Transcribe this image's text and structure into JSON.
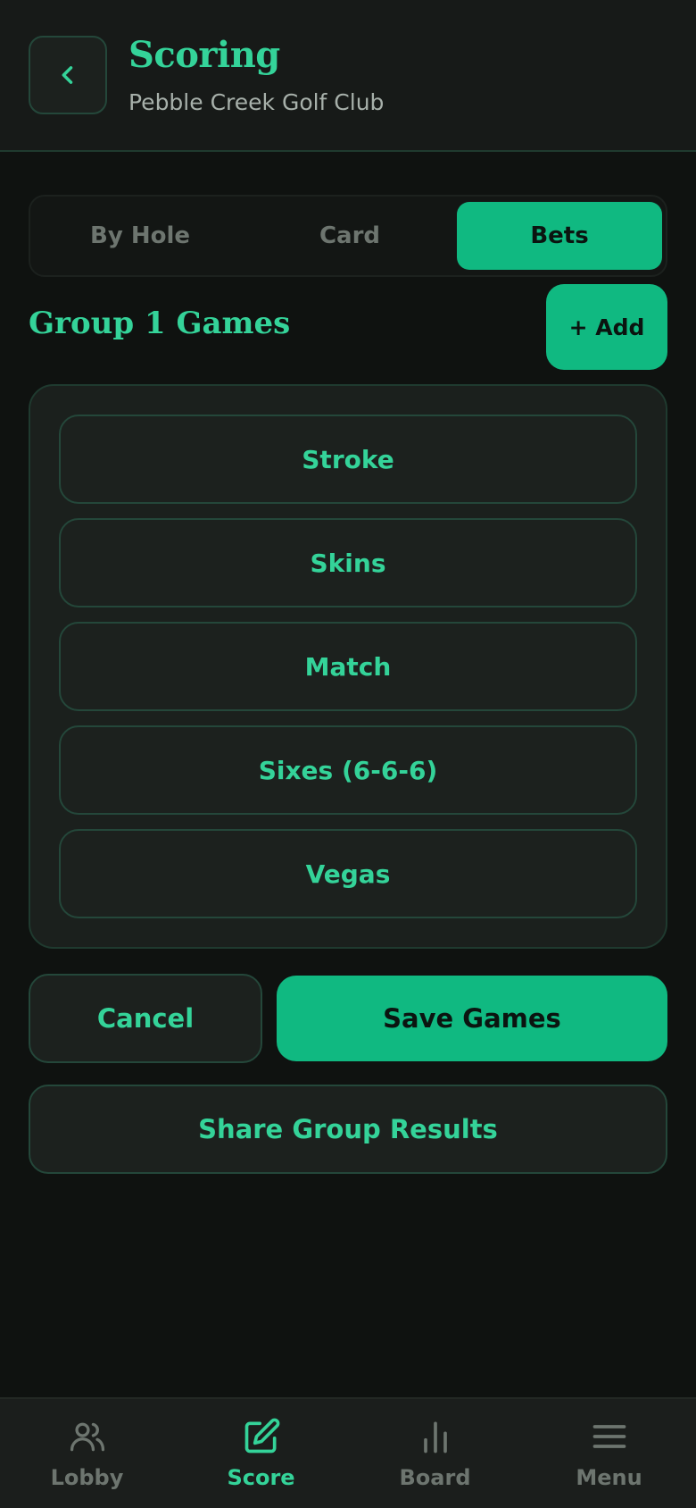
{
  "header": {
    "title": "Scoring",
    "subtitle": "Pebble Creek Golf Club",
    "back_icon": "chevron-left-icon"
  },
  "tabs": [
    {
      "label": "By Hole",
      "active": false
    },
    {
      "label": "Card",
      "active": false
    },
    {
      "label": "Bets",
      "active": true
    }
  ],
  "section": {
    "title": "Group 1 Games",
    "add_label": "+ Add"
  },
  "games": [
    {
      "label": "Stroke"
    },
    {
      "label": "Skins"
    },
    {
      "label": "Match"
    },
    {
      "label": "Sixes (6-6-6)"
    },
    {
      "label": "Vegas"
    }
  ],
  "actions": {
    "cancel_label": "Cancel",
    "save_label": "Save Games",
    "share_label": "Share Group Results"
  },
  "bottom_nav": [
    {
      "label": "Lobby",
      "icon": "users-icon",
      "active": false
    },
    {
      "label": "Score",
      "icon": "edit-icon",
      "active": true
    },
    {
      "label": "Board",
      "icon": "bar-chart-icon",
      "active": false
    },
    {
      "label": "Menu",
      "icon": "menu-icon",
      "active": false
    }
  ],
  "colors": {
    "accent": "#10b981",
    "accent_text": "#34d399",
    "background": "#0f1210",
    "muted": "#6d756f"
  }
}
